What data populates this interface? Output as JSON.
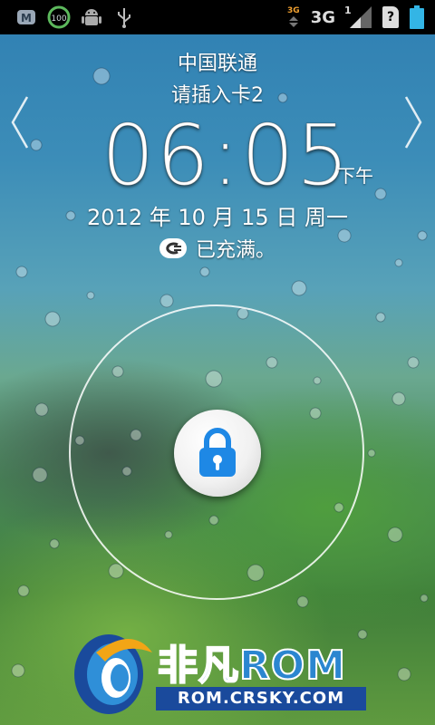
{
  "statusbar": {
    "left_icons": [
      "map-app-icon",
      "battery-100-icon",
      "android-debug-icon",
      "usb-icon"
    ],
    "battery_badge": "100",
    "small_net_label": "3G",
    "network_label": "3G",
    "signal_slot": "1",
    "unknown_sim_glyph": "?"
  },
  "lockscreen": {
    "carrier": "中国联通",
    "sim_status": "请插入卡2",
    "time": "06:05",
    "ampm": "下午",
    "date": "2012 年 10 月 15 日 周一",
    "charge_status": "已充满。"
  },
  "watermark": {
    "brand": "非凡ROM",
    "url": "ROM.CRSKY.COM"
  },
  "colors": {
    "accent_blue": "#1e88e5",
    "statusbar_bg": "#000000",
    "battery_cyan": "#33b5e5"
  }
}
